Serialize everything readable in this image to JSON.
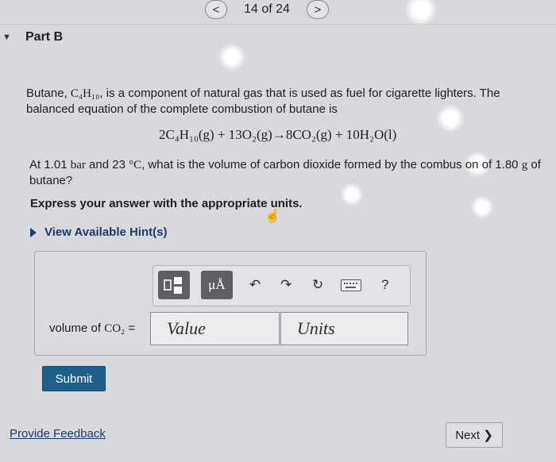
{
  "pager": {
    "prev": "<",
    "position": "14 of 24",
    "next": ">"
  },
  "part": {
    "title": "Part B"
  },
  "question": {
    "intro_1": "Butane, ",
    "intro_formula": "C₄H₁₀",
    "intro_2": ", is a component of natural gas that is used as fuel for cigarette lighters. The balanced equation of the complete combustion of butane is",
    "equation": "2C₄H₁₀(g) + 13O₂(g)→8CO₂(g) + 10H₂O(l)",
    "line_a": "At 1.01 ",
    "bar_unit": "bar",
    "line_b": " and 23 ",
    "temp_unit": "°C",
    "line_c": ", what is the volume of carbon dioxide formed by the combus  on of 1.80 ",
    "mass_unit": "g",
    "line_d": " of",
    "line_e": "butane?",
    "express": "Express your answer with the appropriate units.",
    "hint": "View Available Hint(s)"
  },
  "toolbar": {
    "template_icon": "template-icon",
    "units_btn": "μÅ",
    "undo": "↶",
    "redo": "↷",
    "reset": "↻",
    "keyboard_icon": "keyboard-icon",
    "help": "?"
  },
  "answer": {
    "label_prefix": "volume of ",
    "label_formula": "CO₂",
    "label_eq": " =",
    "value_placeholder": "Value",
    "units_placeholder": "Units"
  },
  "buttons": {
    "submit": "Submit",
    "next": "Next ❯"
  },
  "footer": {
    "feedback": "Provide Feedback"
  }
}
